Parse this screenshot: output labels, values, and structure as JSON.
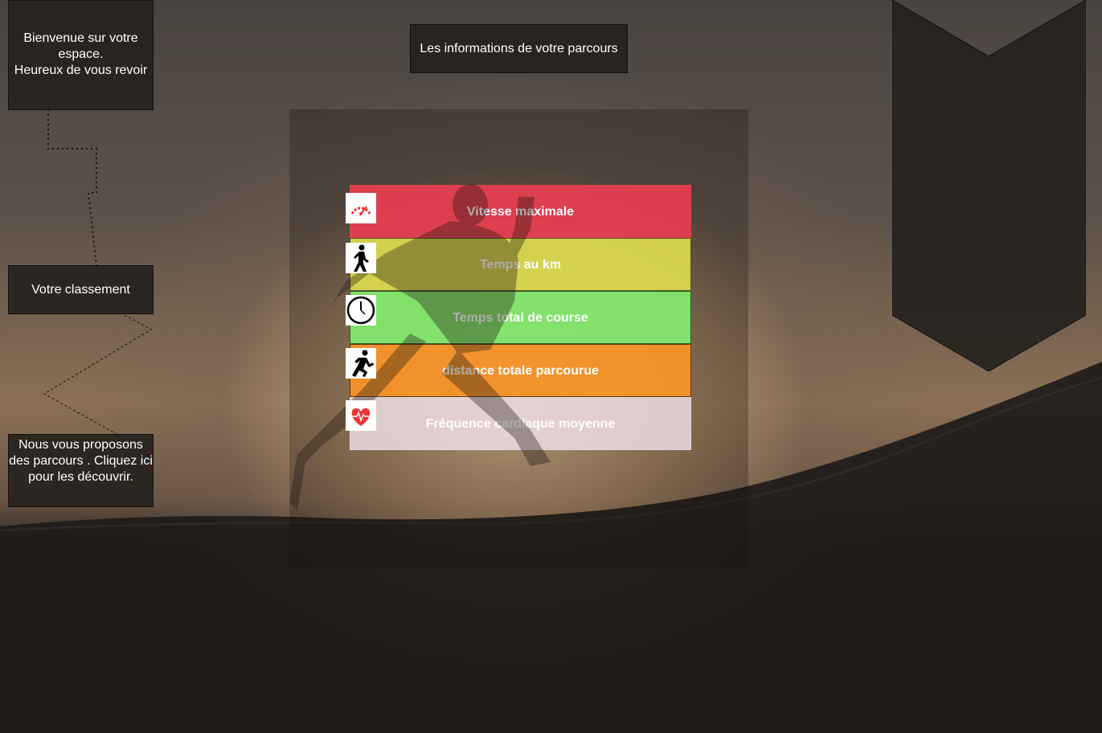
{
  "welcome": {
    "text_line1": "Bienvenue sur votre espace.",
    "text_line2": "Heureux de vous revoir"
  },
  "header": {
    "title": "Les informations de votre parcours"
  },
  "nav": {
    "classement": "Votre classement",
    "parcours": "Nous vous proposons des parcours . Cliquez ici pour les découvrir."
  },
  "metrics": [
    {
      "label": "Vitesse maximale",
      "icon": "speedometer-icon",
      "color": "#e83e50"
    },
    {
      "label": "Temps au km",
      "icon": "walking-icon",
      "color": "#dede50"
    },
    {
      "label": "Temps total de course",
      "icon": "clock-icon",
      "color": "#82eb6e"
    },
    {
      "label": "distance totale parcourue",
      "icon": "running-icon",
      "color": "#f89428"
    },
    {
      "label": "Fréquence cardiaque moyenne",
      "icon": "heart-rate-icon",
      "color": "#f0e1e6"
    }
  ]
}
